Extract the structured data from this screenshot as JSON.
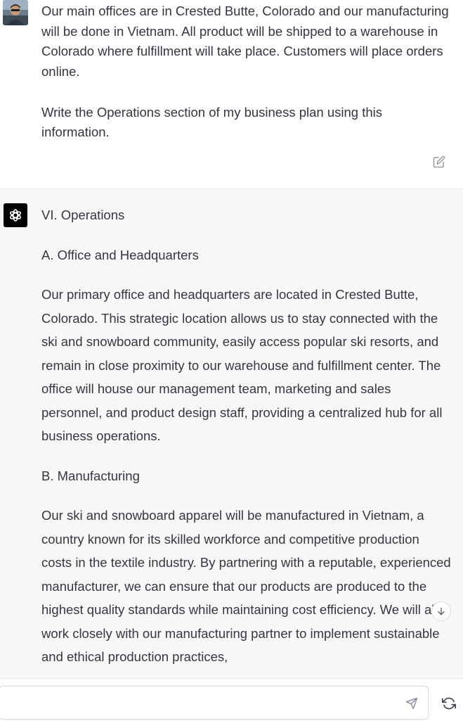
{
  "user_message": {
    "text": "Our main offices are in Crested Butte, Colorado and our manufacturing will be done in Vietnam. All product will be shipped to a warehouse in Colorado where fulfillment will take place. Customers will place orders online.\n\nWrite the Operations section of my business plan using this information."
  },
  "assistant_message": {
    "section_title": "VI. Operations",
    "office_heading": "A. Office and Headquarters",
    "office_text": "Our primary office and headquarters are located in Crested Butte, Colorado. This strategic location allows us to stay connected with the ski and snowboard community, easily access popular ski resorts, and remain in close proximity to our warehouse and fulfillment center. The office will house our management team, marketing and sales personnel, and product design staff, providing a centralized hub for all business operations.",
    "manufacturing_heading": "B. Manufacturing",
    "manufacturing_text": "Our ski and snowboard apparel will be manufactured in Vietnam, a country known for its skilled workforce and competitive production costs in the textile industry. By partnering with a reputable, experienced manufacturer, we can ensure that our products are produced to the highest quality standards while maintaining cost efficiency. We will also work closely with our manufacturing partner to implement sustainable and ethical production practices,"
  },
  "icons": {
    "edit": "edit-icon",
    "logo": "openai-logo-icon",
    "scroll": "arrow-down-icon",
    "send": "send-icon",
    "regenerate": "regenerate-icon"
  },
  "composer": {
    "value": "",
    "placeholder": ""
  },
  "colors": {
    "assistant_bg": "#f7f7f8",
    "text": "#353740",
    "border": "#d9d9e3"
  }
}
